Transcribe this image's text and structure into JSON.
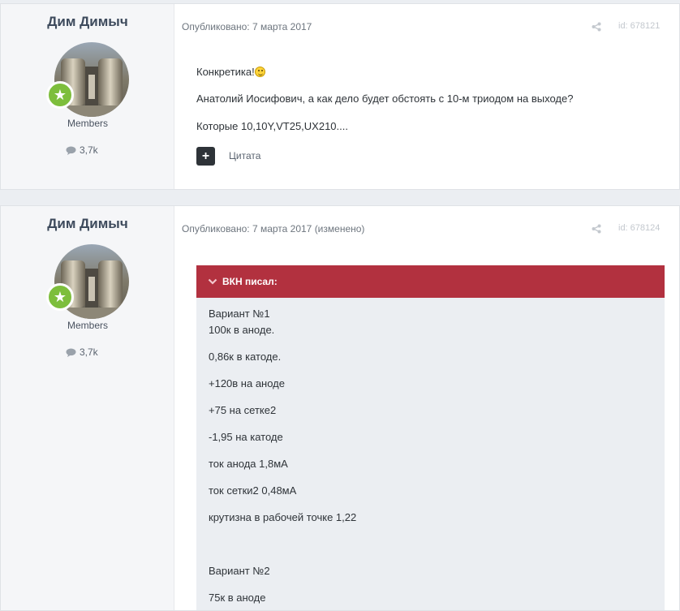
{
  "posts": [
    {
      "author": "Дим Димыч",
      "group": "Members",
      "reputation": "3,7k",
      "meta": "Опубликовано: 7 марта 2017",
      "post_id": "id: 678121",
      "lines": [
        "Конкретика!",
        "Анатолий Иосифович, а как дело будет обстоять с 10-м триодом на выходе?",
        "Которые 10,10Y,VT25,UX210...."
      ],
      "quote_button": "+",
      "quote_label": "Цитата"
    },
    {
      "author": "Дим Димыч",
      "group": "Members",
      "reputation": "3,7k",
      "meta": "Опубликовано: 7 марта 2017 (изменено)",
      "post_id": "id: 678124",
      "quote": {
        "header": "ВКН писал:",
        "lines": [
          "Вариант №1",
          "100к в аноде.",
          "0,86к в катоде.",
          "+120в на аноде",
          "+75 на сетке2",
          "-1,95 на катоде",
          "ток анода 1,8мА",
          "ток сетки2 0,48мА",
          "крутизна в рабочей точке 1,22",
          "Вариант №2",
          "75к в аноде"
        ]
      }
    }
  ],
  "colors": {
    "quote_header": "#b2313f",
    "badge": "#7dbe3c",
    "author_name": "#3d4a5c"
  },
  "icons": [
    "avatar",
    "star-badge-icon",
    "comment-icon",
    "share-icon",
    "chevron-down-icon",
    "plus-icon",
    "smiley-icon"
  ]
}
